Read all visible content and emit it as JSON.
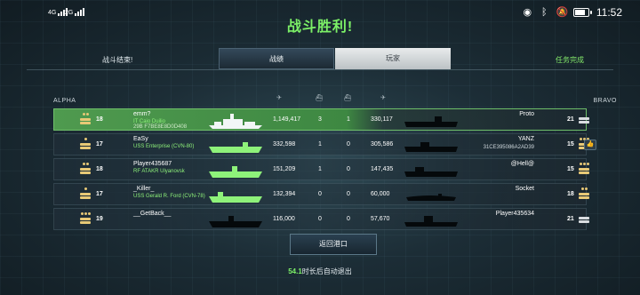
{
  "status_bar": {
    "signal1": "4G",
    "signal2": "2G",
    "time": "11:52"
  },
  "title": "战斗胜利!",
  "nav": {
    "left_label": "战斗结束!",
    "tab_stats": "战绩",
    "tab_players": "玩家",
    "right_label": "任务完成"
  },
  "teams": {
    "left": "ALPHA",
    "right": "BRAVO"
  },
  "column_icons": [
    "damage-icon",
    "kills-icon",
    "assists-icon",
    "points-icon"
  ],
  "rows": [
    {
      "left_level": "18",
      "left_name": "emm?",
      "left_ship": "IT Caio Duilio",
      "left_ship_extra": "29B F7BE8E8D0D408",
      "damage": "1,149,417",
      "kills": "3",
      "assists": "1",
      "points": "330,117",
      "right_name": "Proto",
      "right_sub": "",
      "right_level": "21",
      "highlight": true
    },
    {
      "left_level": "17",
      "left_name": "EaSy",
      "left_ship": "USS Enterprise (CVN-80)",
      "left_ship_extra": "",
      "damage": "332,598",
      "kills": "1",
      "assists": "0",
      "points": "305,586",
      "right_name": "YANZ",
      "right_sub": "31CE395086A2AD39",
      "right_level": "15",
      "highlight": false
    },
    {
      "left_level": "18",
      "left_name": "Player435687",
      "left_ship": "RF ATAKR Ulyanovsk",
      "left_ship_extra": "",
      "damage": "151,209",
      "kills": "1",
      "assists": "0",
      "points": "147,435",
      "right_name": "@Hell@",
      "right_sub": "",
      "right_level": "15",
      "highlight": false
    },
    {
      "left_level": "17",
      "left_name": "_Killer_",
      "left_ship": "USS Gerald R. Ford (CVN-78)",
      "left_ship_extra": "",
      "damage": "132,394",
      "kills": "0",
      "assists": "0",
      "points": "60,000",
      "right_name": "Socket",
      "right_sub": "",
      "right_level": "18",
      "highlight": false
    },
    {
      "left_level": "19",
      "left_name": "__GetBack__",
      "left_ship": "",
      "left_ship_extra": "",
      "damage": "116,000",
      "kills": "0",
      "assists": "0",
      "points": "57,670",
      "right_name": "Player435634",
      "right_sub": "",
      "right_level": "21",
      "highlight": false
    }
  ],
  "return_button": "返回港口",
  "countdown": {
    "seconds": "54.1",
    "text": "时长后自动退出"
  },
  "colors": {
    "accent_green": "#7cf067",
    "highlight_row": "#4f9a4f"
  }
}
